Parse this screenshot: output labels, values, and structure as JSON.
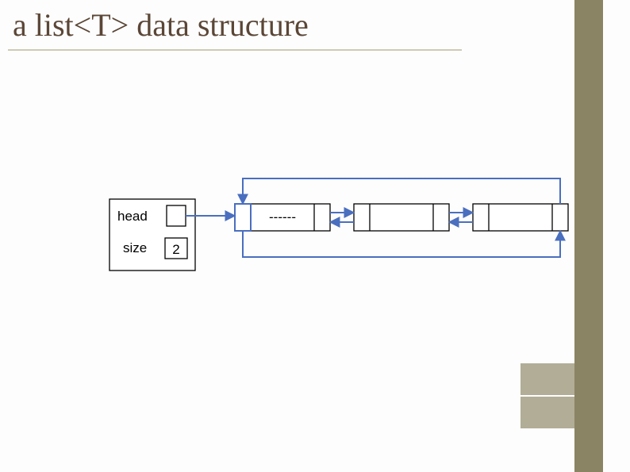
{
  "title": "a list<T> data structure",
  "list": {
    "head_label": "head",
    "size_label": "size",
    "size_value": "2",
    "sentinel_value": "------"
  }
}
